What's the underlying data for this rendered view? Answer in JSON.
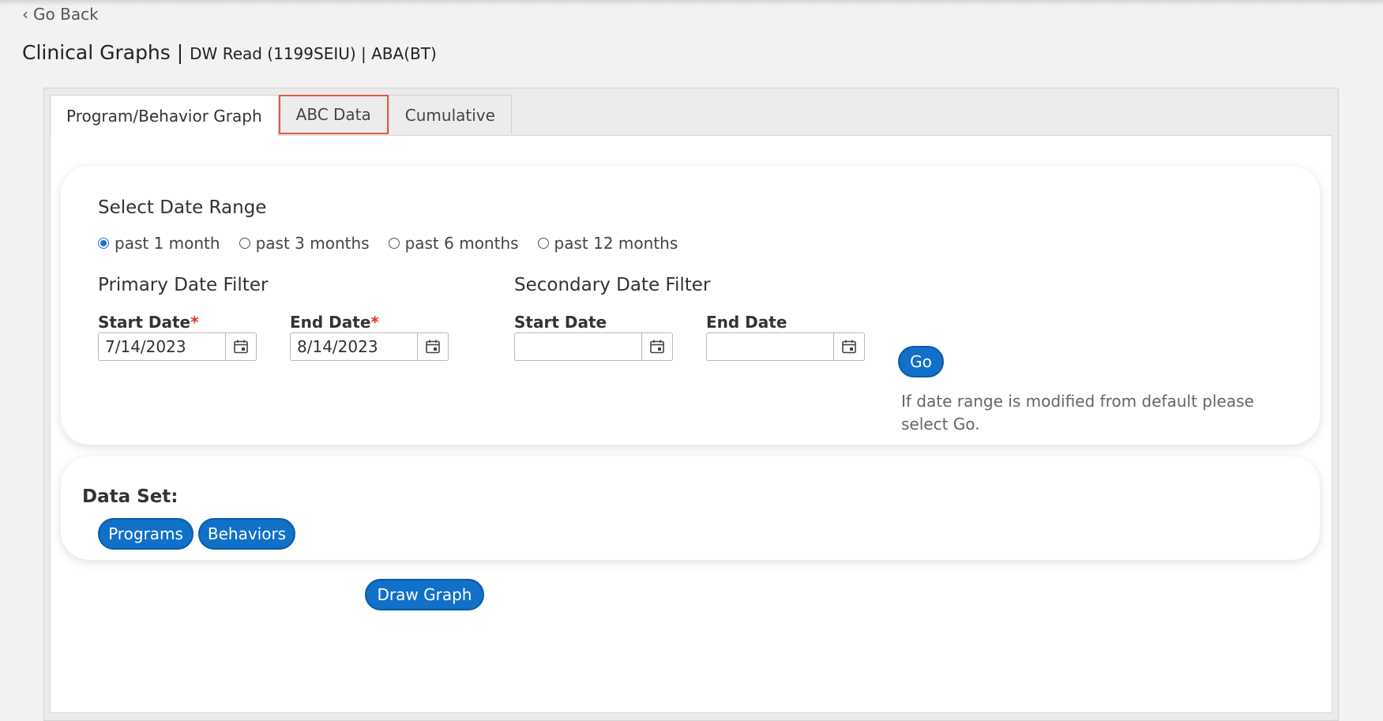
{
  "nav": {
    "go_back": "Go Back"
  },
  "header": {
    "title": "Clinical Graphs",
    "separator": "|",
    "subtitle": "DW Read (1199SEIU) | ABA(BT)"
  },
  "tabs": [
    {
      "label": "Program/Behavior Graph"
    },
    {
      "label": "ABC Data"
    },
    {
      "label": "Cumulative"
    }
  ],
  "date_range": {
    "title": "Select Date Range",
    "options": [
      "past 1 month",
      "past 3 months",
      "past 6 months",
      "past 12 months"
    ],
    "selected": "past 1 month"
  },
  "primary_filter": {
    "title": "Primary Date Filter",
    "start_label": "Start Date",
    "end_label": "End Date",
    "required_mark": "*",
    "start_value": "7/14/2023",
    "end_value": "8/14/2023"
  },
  "secondary_filter": {
    "title": "Secondary Date Filter",
    "start_label": "Start Date",
    "end_label": "End Date",
    "start_value": "",
    "end_value": ""
  },
  "go_button": "Go",
  "hint": "If date range is modified from default please select Go.",
  "dataset": {
    "label": "Data Set:",
    "buttons": [
      "Programs",
      "Behaviors"
    ]
  },
  "draw_graph_button": "Draw Graph",
  "colors": {
    "primary_button": "#1170c8",
    "focus_outline": "#e05a4a",
    "required": "#d33333"
  }
}
